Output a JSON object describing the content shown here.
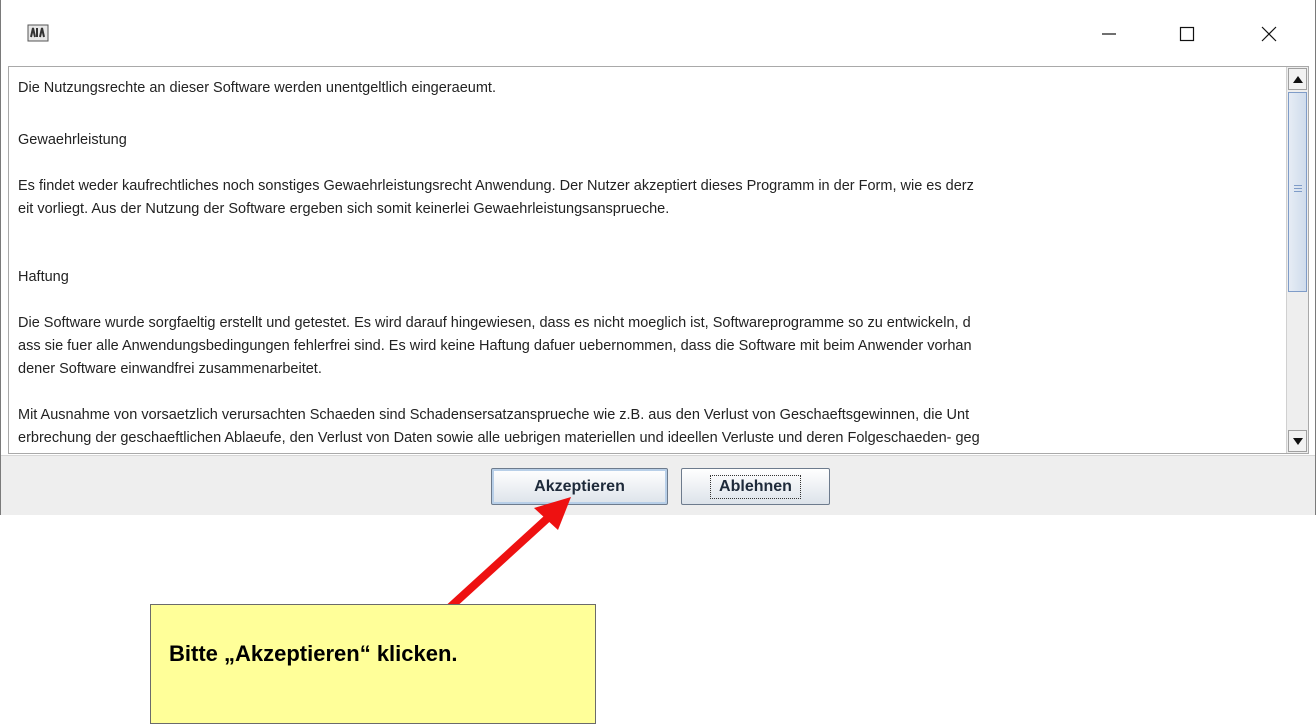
{
  "window": {
    "controls": {
      "minimize": "minimize-icon",
      "maximize": "maximize-icon",
      "close": "close-icon"
    },
    "app_icon": "java-app-icon"
  },
  "license": {
    "intro": "Die Nutzungsrechte an dieser Software werden unentgeltlich eingeraeumt.",
    "warranty_heading": "Gewaehrleistung",
    "warranty_line1": "Es findet weder kaufrechtliches noch sonstiges Gewaehrleistungsrecht Anwendung. Der Nutzer akzeptiert dieses Programm in der Form, wie es derz",
    "warranty_line2": "eit vorliegt. Aus der Nutzung der Software ergeben sich somit keinerlei Gewaehrleistungsansprueche.",
    "liability_heading": "Haftung",
    "liability_line1": "Die Software wurde sorgfaeltig erstellt und getestet. Es wird darauf hingewiesen, dass es nicht moeglich ist, Softwareprogramme so zu entwickeln, d",
    "liability_line2": "ass sie fuer alle Anwendungsbedingungen fehlerfrei sind. Es wird keine Haftung dafuer uebernommen, dass die Software mit beim Anwender vorhan",
    "liability_line3": "dener Software einwandfrei zusammenarbeitet.",
    "damages_line1": "Mit Ausnahme von vorsaetzlich verursachten Schaeden sind Schadensersatzansprueche wie z.B. aus den Verlust von Geschaeftsgewinnen, die Unt",
    "damages_line2": "erbrechung der geschaeftlichen Ablaeufe, den Verlust von Daten sowie alle uebrigen materiellen und ideellen Verluste und deren Folgeschaeden- geg"
  },
  "buttons": {
    "accept": "Akzeptieren",
    "decline": "Ablehnen"
  },
  "annotation": {
    "callout_text": "Bitte „Akzeptieren“ klicken.",
    "arrow_color": "#ee1111",
    "callout_color": "#ffff99"
  }
}
